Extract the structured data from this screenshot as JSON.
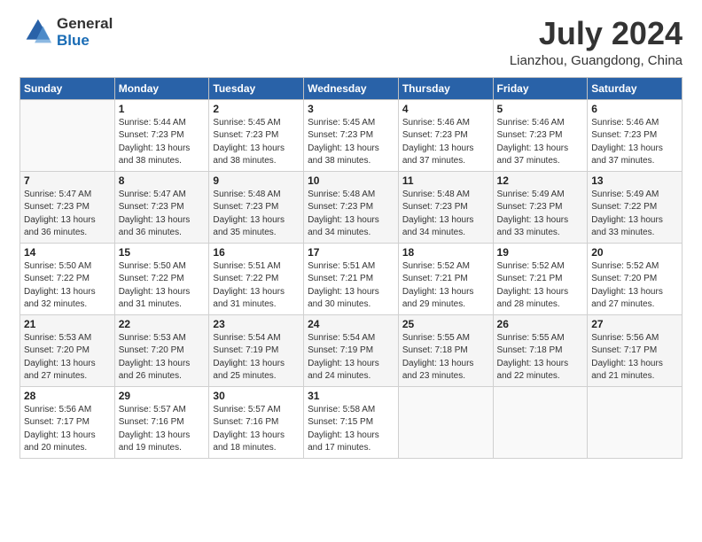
{
  "header": {
    "logo_general": "General",
    "logo_blue": "Blue",
    "month_year": "July 2024",
    "location": "Lianzhou, Guangdong, China"
  },
  "days_of_week": [
    "Sunday",
    "Monday",
    "Tuesday",
    "Wednesday",
    "Thursday",
    "Friday",
    "Saturday"
  ],
  "weeks": [
    [
      {
        "day": "",
        "detail": ""
      },
      {
        "day": "1",
        "detail": "Sunrise: 5:44 AM\nSunset: 7:23 PM\nDaylight: 13 hours\nand 38 minutes."
      },
      {
        "day": "2",
        "detail": "Sunrise: 5:45 AM\nSunset: 7:23 PM\nDaylight: 13 hours\nand 38 minutes."
      },
      {
        "day": "3",
        "detail": "Sunrise: 5:45 AM\nSunset: 7:23 PM\nDaylight: 13 hours\nand 38 minutes."
      },
      {
        "day": "4",
        "detail": "Sunrise: 5:46 AM\nSunset: 7:23 PM\nDaylight: 13 hours\nand 37 minutes."
      },
      {
        "day": "5",
        "detail": "Sunrise: 5:46 AM\nSunset: 7:23 PM\nDaylight: 13 hours\nand 37 minutes."
      },
      {
        "day": "6",
        "detail": "Sunrise: 5:46 AM\nSunset: 7:23 PM\nDaylight: 13 hours\nand 37 minutes."
      }
    ],
    [
      {
        "day": "7",
        "detail": "Sunrise: 5:47 AM\nSunset: 7:23 PM\nDaylight: 13 hours\nand 36 minutes."
      },
      {
        "day": "8",
        "detail": "Sunrise: 5:47 AM\nSunset: 7:23 PM\nDaylight: 13 hours\nand 36 minutes."
      },
      {
        "day": "9",
        "detail": "Sunrise: 5:48 AM\nSunset: 7:23 PM\nDaylight: 13 hours\nand 35 minutes."
      },
      {
        "day": "10",
        "detail": "Sunrise: 5:48 AM\nSunset: 7:23 PM\nDaylight: 13 hours\nand 34 minutes."
      },
      {
        "day": "11",
        "detail": "Sunrise: 5:48 AM\nSunset: 7:23 PM\nDaylight: 13 hours\nand 34 minutes."
      },
      {
        "day": "12",
        "detail": "Sunrise: 5:49 AM\nSunset: 7:23 PM\nDaylight: 13 hours\nand 33 minutes."
      },
      {
        "day": "13",
        "detail": "Sunrise: 5:49 AM\nSunset: 7:22 PM\nDaylight: 13 hours\nand 33 minutes."
      }
    ],
    [
      {
        "day": "14",
        "detail": "Sunrise: 5:50 AM\nSunset: 7:22 PM\nDaylight: 13 hours\nand 32 minutes."
      },
      {
        "day": "15",
        "detail": "Sunrise: 5:50 AM\nSunset: 7:22 PM\nDaylight: 13 hours\nand 31 minutes."
      },
      {
        "day": "16",
        "detail": "Sunrise: 5:51 AM\nSunset: 7:22 PM\nDaylight: 13 hours\nand 31 minutes."
      },
      {
        "day": "17",
        "detail": "Sunrise: 5:51 AM\nSunset: 7:21 PM\nDaylight: 13 hours\nand 30 minutes."
      },
      {
        "day": "18",
        "detail": "Sunrise: 5:52 AM\nSunset: 7:21 PM\nDaylight: 13 hours\nand 29 minutes."
      },
      {
        "day": "19",
        "detail": "Sunrise: 5:52 AM\nSunset: 7:21 PM\nDaylight: 13 hours\nand 28 minutes."
      },
      {
        "day": "20",
        "detail": "Sunrise: 5:52 AM\nSunset: 7:20 PM\nDaylight: 13 hours\nand 27 minutes."
      }
    ],
    [
      {
        "day": "21",
        "detail": "Sunrise: 5:53 AM\nSunset: 7:20 PM\nDaylight: 13 hours\nand 27 minutes."
      },
      {
        "day": "22",
        "detail": "Sunrise: 5:53 AM\nSunset: 7:20 PM\nDaylight: 13 hours\nand 26 minutes."
      },
      {
        "day": "23",
        "detail": "Sunrise: 5:54 AM\nSunset: 7:19 PM\nDaylight: 13 hours\nand 25 minutes."
      },
      {
        "day": "24",
        "detail": "Sunrise: 5:54 AM\nSunset: 7:19 PM\nDaylight: 13 hours\nand 24 minutes."
      },
      {
        "day": "25",
        "detail": "Sunrise: 5:55 AM\nSunset: 7:18 PM\nDaylight: 13 hours\nand 23 minutes."
      },
      {
        "day": "26",
        "detail": "Sunrise: 5:55 AM\nSunset: 7:18 PM\nDaylight: 13 hours\nand 22 minutes."
      },
      {
        "day": "27",
        "detail": "Sunrise: 5:56 AM\nSunset: 7:17 PM\nDaylight: 13 hours\nand 21 minutes."
      }
    ],
    [
      {
        "day": "28",
        "detail": "Sunrise: 5:56 AM\nSunset: 7:17 PM\nDaylight: 13 hours\nand 20 minutes."
      },
      {
        "day": "29",
        "detail": "Sunrise: 5:57 AM\nSunset: 7:16 PM\nDaylight: 13 hours\nand 19 minutes."
      },
      {
        "day": "30",
        "detail": "Sunrise: 5:57 AM\nSunset: 7:16 PM\nDaylight: 13 hours\nand 18 minutes."
      },
      {
        "day": "31",
        "detail": "Sunrise: 5:58 AM\nSunset: 7:15 PM\nDaylight: 13 hours\nand 17 minutes."
      },
      {
        "day": "",
        "detail": ""
      },
      {
        "day": "",
        "detail": ""
      },
      {
        "day": "",
        "detail": ""
      }
    ]
  ]
}
